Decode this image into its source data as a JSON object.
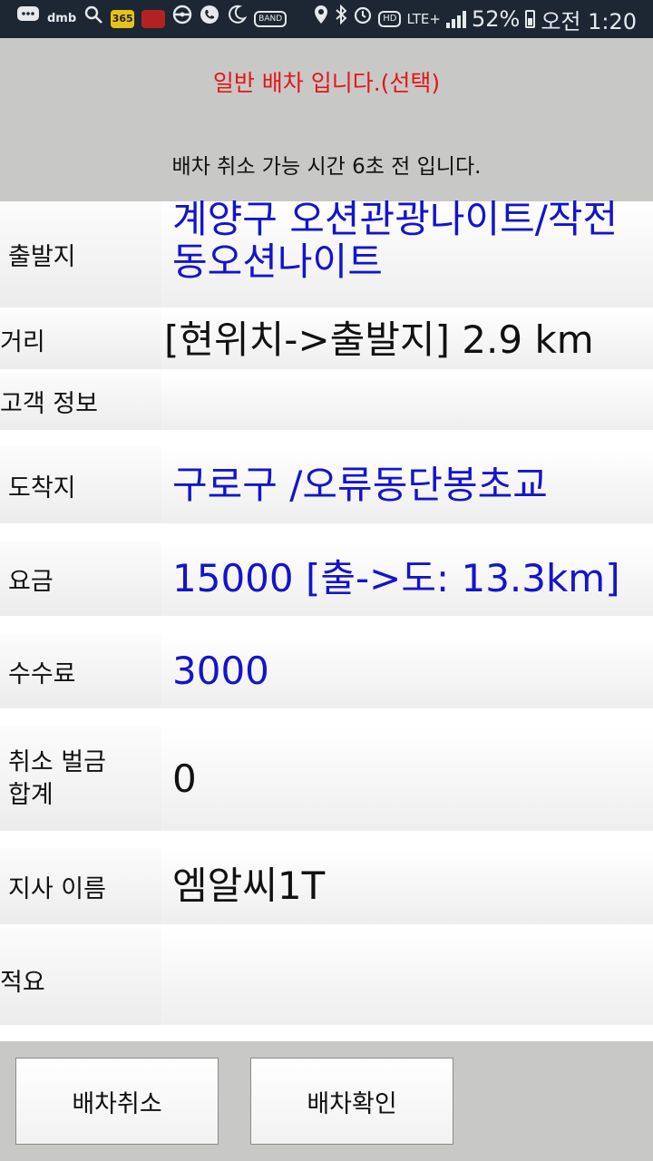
{
  "status_bar": {
    "battery": "52%",
    "time": "오전 1:20",
    "network": "LTE+",
    "hd": "HD",
    "dmb": "dmb",
    "app_badge": "365",
    "band": "BAND"
  },
  "notice": {
    "title": "일반 배차 입니다.(선택)",
    "message": "배차 취소 가능 시간 6초 전 입니다."
  },
  "rows": {
    "departure": {
      "label": "출발지",
      "value": "계양구 오션관광나이트/작전동오션나이트"
    },
    "distance": {
      "label": "거리",
      "value": "[현위치->출발지] 2.9 km"
    },
    "customer": {
      "label": "고객 정보",
      "value": ""
    },
    "arrival": {
      "label": "도착지",
      "value": "구로구 /오류동단봉초교"
    },
    "fare": {
      "label": "요금",
      "value": "15000 [출->도: 13.3km]"
    },
    "fee": {
      "label": "수수료",
      "value": "3000"
    },
    "penalty": {
      "label": "취소 벌금 합계",
      "value": "0"
    },
    "branch": {
      "label": "지사 이름",
      "value": "엠알씨1T"
    },
    "memo": {
      "label": "적요",
      "value": ""
    }
  },
  "buttons": {
    "cancel": "배차취소",
    "confirm": "배차확인"
  },
  "colors": {
    "status_bar_bg": "#1c2733",
    "notice_bg": "#c8c8c6",
    "notice_title": "#e3151a",
    "value_blue": "#1414cc"
  }
}
